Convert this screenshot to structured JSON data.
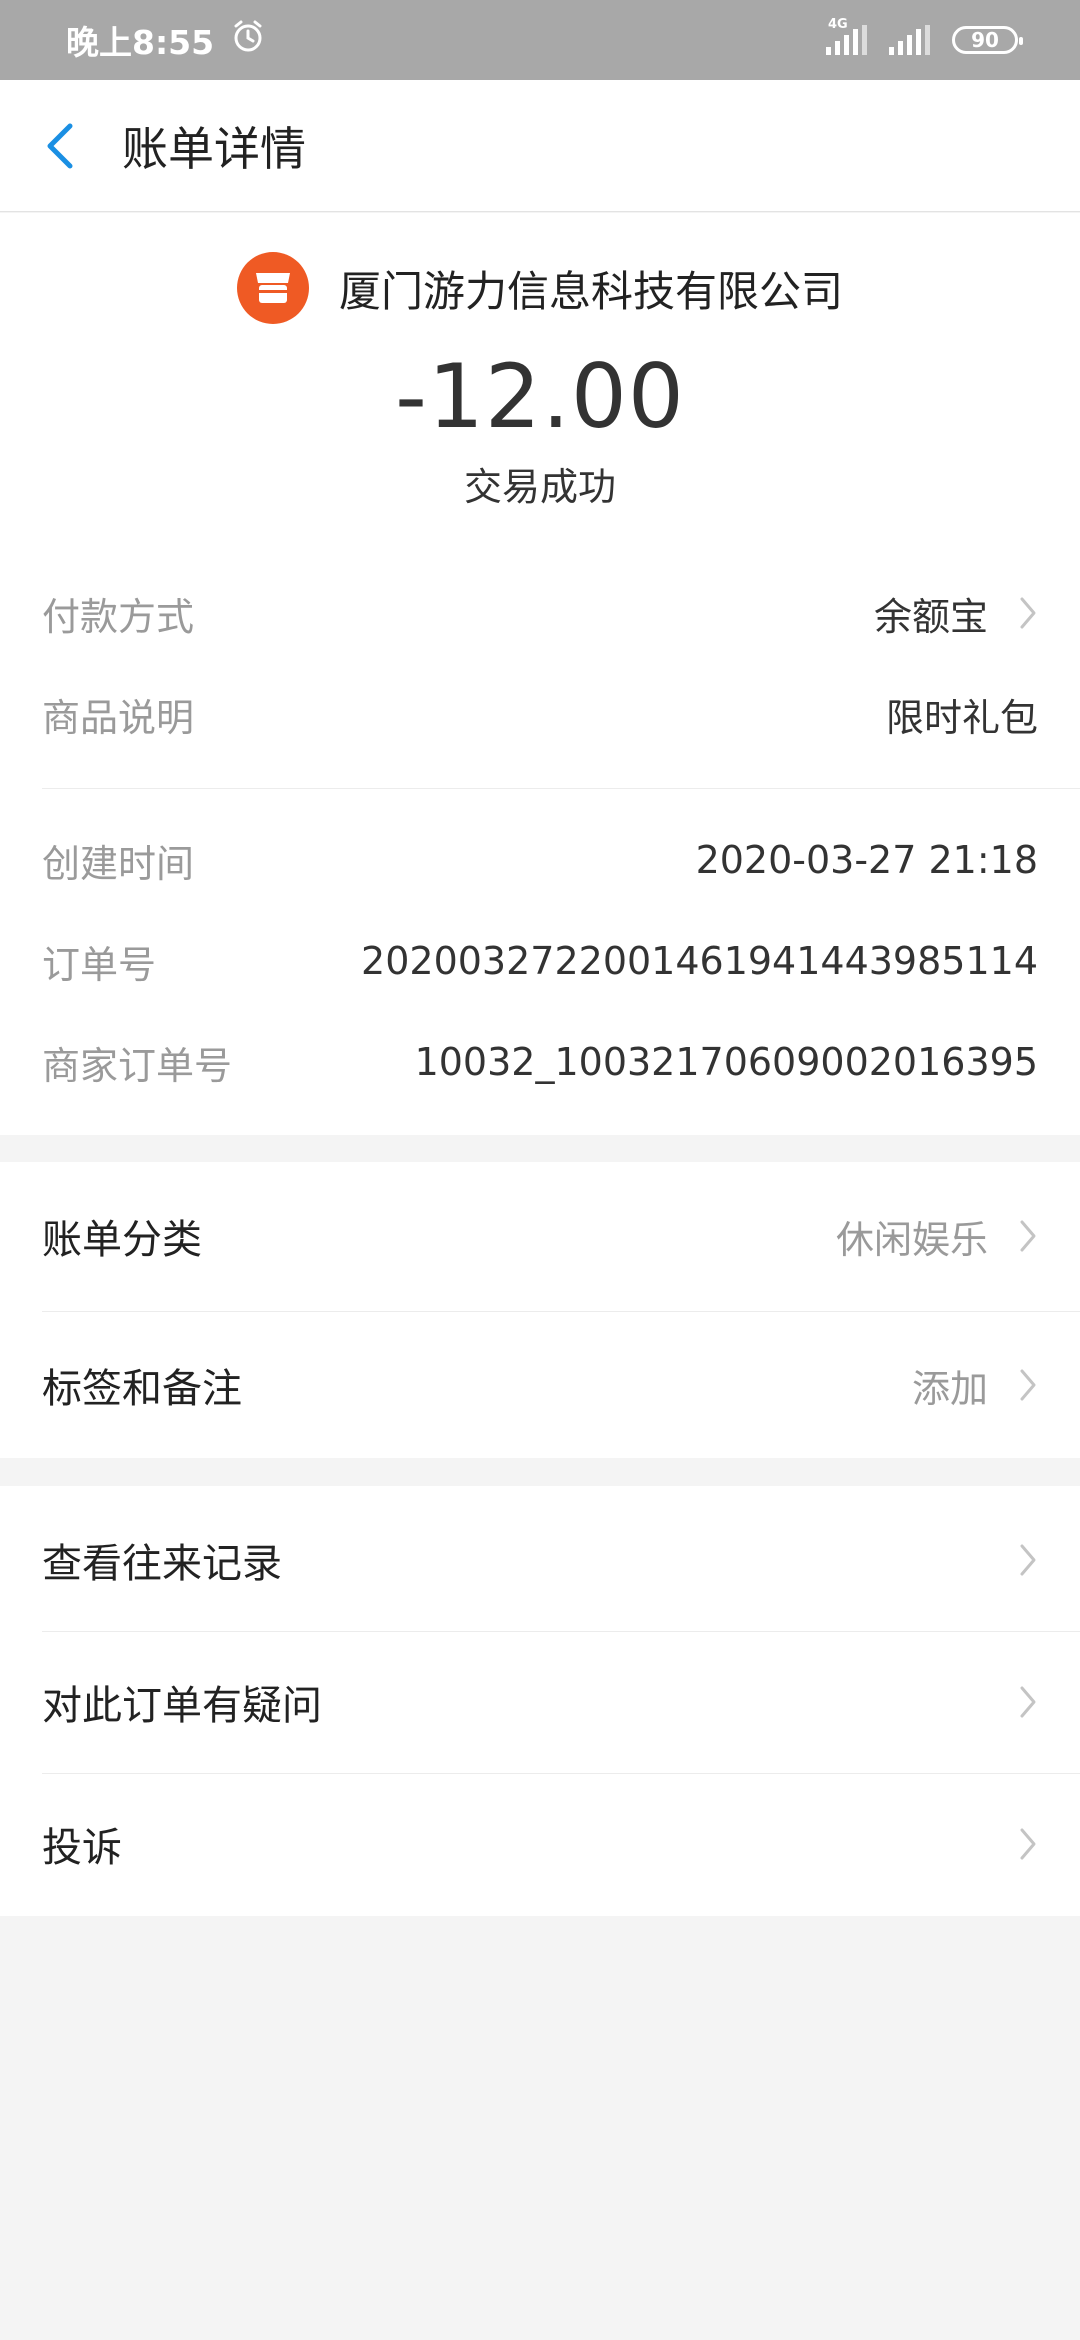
{
  "status_bar": {
    "time": "晚上8:55",
    "network": "4G",
    "battery": "90"
  },
  "header": {
    "title": "账单详情"
  },
  "merchant": {
    "name": "厦门游力信息科技有限公司",
    "icon": "store-icon"
  },
  "transaction": {
    "amount": "-12.00",
    "status": "交易成功"
  },
  "details": {
    "payment_method_label": "付款方式",
    "payment_method_value": "余额宝",
    "product_label": "商品说明",
    "product_value": "限时礼包",
    "created_label": "创建时间",
    "created_value": "2020-03-27 21:18",
    "order_no_label": "订单号",
    "order_no_value": "2020032722001461941443985114",
    "merchant_order_label": "商家订单号",
    "merchant_order_value": "10032_10032170609002016395"
  },
  "category": {
    "label": "账单分类",
    "value": "休闲娱乐"
  },
  "tags": {
    "label": "标签和备注",
    "value": "添加"
  },
  "actions": {
    "history": "查看往来记录",
    "question": "对此订单有疑问",
    "complaint": "投诉"
  },
  "colors": {
    "accent": "#1a8fe3",
    "merchant_icon": "#ef5a24",
    "status_bar": "#a8a8a8"
  }
}
